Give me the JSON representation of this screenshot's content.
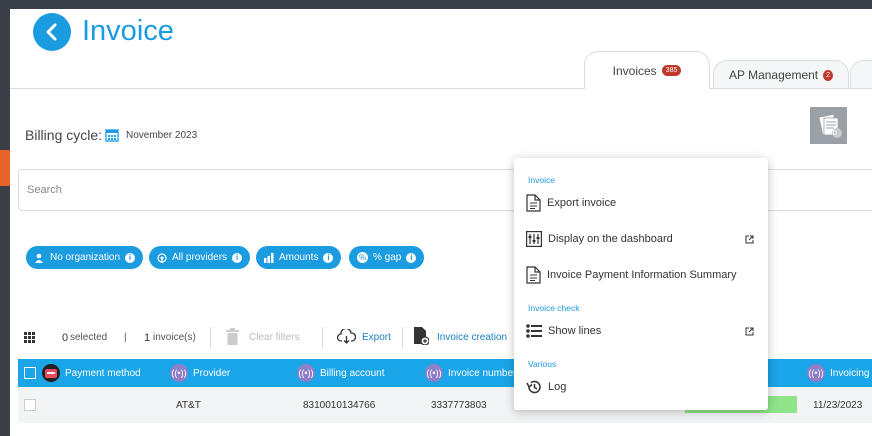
{
  "header": {
    "title": "Invoice"
  },
  "tabs": [
    {
      "label": "Invoices",
      "badge": "385"
    },
    {
      "label": "AP Management",
      "badge": "2"
    }
  ],
  "billing": {
    "label": "Billing cycle:",
    "value": "November 2023"
  },
  "doc_widget": {
    "count": "0"
  },
  "search": {
    "placeholder": "Search"
  },
  "filters": [
    {
      "label": "No organization"
    },
    {
      "label": "All providers"
    },
    {
      "label": "Amounts"
    },
    {
      "label": "% gap"
    }
  ],
  "toolbar": {
    "selected_count": "0",
    "selected_label": "selected",
    "separator": "|",
    "invoice_count": "1",
    "invoice_label": "invoice(s)",
    "clear_filters": "Clear filters",
    "export": "Export",
    "invoice_creation": "Invoice creation"
  },
  "table": {
    "columns": [
      "Payment method",
      "Provider",
      "Billing account",
      "Invoice number",
      "Invoicing d"
    ],
    "rows": [
      {
        "provider": "AT&T",
        "billing_account": "8310010134766",
        "invoice_number": "3337773803",
        "invoicing_date": "11/23/2023"
      }
    ]
  },
  "menu": {
    "sections": [
      {
        "title": "Invoice",
        "items": [
          {
            "label": "Export invoice"
          },
          {
            "label": "Display on the dashboard"
          },
          {
            "label": "Invoice Payment Information Summary"
          }
        ]
      },
      {
        "title": "Invoice check",
        "items": [
          {
            "label": "Show lines"
          }
        ]
      },
      {
        "title": "Various",
        "items": [
          {
            "label": "Log"
          }
        ]
      }
    ]
  },
  "colors": {
    "accent": "#1b9be0",
    "header_bg": "#1aa5e8",
    "badge": "#c0392b",
    "status_green": "#8fe48a"
  }
}
